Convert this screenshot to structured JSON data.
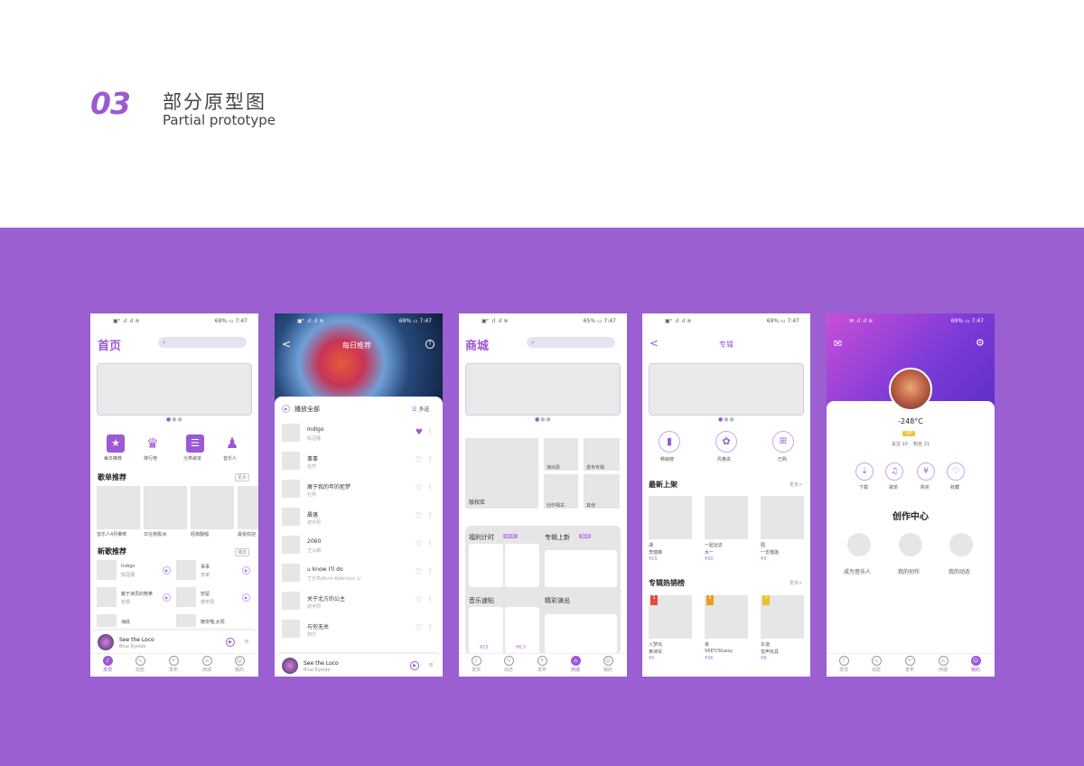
{
  "header": {
    "number": "03",
    "title_zh": "部分原型图",
    "title_en": "Partial prototype"
  },
  "colors": {
    "accent": "#9b59d3",
    "band": "#9b5fd1"
  },
  "phone1": {
    "status": {
      "left": "▣ᵉ .ıl .ıl ≋",
      "right": "69% ▭ 7:47"
    },
    "title": "首页",
    "icons": [
      {
        "label": "每日推荐",
        "icon": "star-bookmark-icon"
      },
      {
        "label": "排行榜",
        "icon": "trophy-icon"
      },
      {
        "label": "分类歌单",
        "icon": "playlist-icon"
      },
      {
        "label": "音乐人",
        "icon": "person-icon"
      }
    ],
    "playlist_section": "歌单推荐",
    "playlist_more": "更多",
    "playlists": [
      "音乐人4月推荐",
      "日在南极洲",
      "经典翻唱",
      "最受欢迎"
    ],
    "newsong_section": "新歌推荐",
    "newsong_more": "播放",
    "newsongs": [
      {
        "name": "Indigo",
        "artist": "陈冠蒲"
      },
      {
        "name": "事事",
        "artist": "李荣"
      },
      {
        "name": "戴于演员的鞋拳",
        "artist": "杜杨"
      },
      {
        "name": "想留",
        "artist": "谢宇周"
      },
      {
        "name": "海底",
        "artist": ""
      },
      {
        "name": "晚安喵,太阳",
        "artist": ""
      }
    ],
    "mini": {
      "title": "See the Loco",
      "artist": "Blue Eyeide"
    },
    "tabs": [
      "发现",
      "动态",
      "发布",
      "商城",
      "我的"
    ]
  },
  "phone2": {
    "status": {
      "left": "▣ᵉ .ıl .ıl ≋",
      "right": "69% ▭ 7:47"
    },
    "title": "每日推荐",
    "play_all": "播放全部",
    "multi": "多选",
    "songs": [
      {
        "name": "Indigo",
        "artist": "陈冠蒲"
      },
      {
        "name": "事事",
        "artist": "任然"
      },
      {
        "name": "屑于我的年的拒梦",
        "artist": "杜杨"
      },
      {
        "name": "晨落",
        "artist": "谢宇周"
      },
      {
        "name": "2060",
        "artist": "王以朗"
      },
      {
        "name": "u know I'll do",
        "artist": "丁光亮/Alvin Robinson Li"
      },
      {
        "name": "关于北方的公主",
        "artist": "谢宇周"
      },
      {
        "name": "与你无关",
        "artist": "阿冗"
      }
    ],
    "mini": {
      "title": "See the Loco",
      "artist": "Blue Eyeide"
    }
  },
  "phone3": {
    "status": {
      "left": "▣ᵉ .ıl .ıl ≋",
      "right": "65% ▭ 7:47"
    },
    "title": "商城",
    "tiles": [
      "版权库",
      "演出票",
      "发布专辑",
      "创作相关",
      "其他"
    ],
    "welfare": "福利计时",
    "new_album": "专辑上新",
    "sticker": "音乐速贴",
    "show": "精彩演出",
    "prices": [
      "¥15",
      "¥6.5"
    ],
    "tabs": [
      "发现",
      "动态",
      "发布",
      "商城",
      "我的"
    ]
  },
  "phone4": {
    "status": {
      "left": "▣ᵉ .ıl .ıl ≋",
      "right": "69% ▭ 7:47"
    },
    "title": "专辑",
    "cats": [
      "畅销榜",
      "风格说",
      "已购"
    ],
    "latest": "最新上架",
    "latest_more": "更多>",
    "albums": [
      {
        "name": "湖",
        "artist": "李健峰",
        "price": "¥15"
      },
      {
        "name": "一起远去",
        "artist": "水一",
        "price": "¥30"
      },
      {
        "name": "囿",
        "artist": "一支榴莲",
        "price": "¥3"
      }
    ],
    "hot": "专辑热销榜",
    "hot_more": "更多>",
    "hots": [
      {
        "rank": "1",
        "name": "入梦出",
        "artist": "黄诗扶",
        "price": "¥5",
        "color": "#e14c3b"
      },
      {
        "rank": "2",
        "name": "夜",
        "artist": "VKEY/Stussy",
        "price": "¥36",
        "color": "#f09a1f"
      },
      {
        "rank": "3",
        "name": "失谐",
        "artist": "音声玩具",
        "price": "¥8",
        "color": "#e8c225"
      }
    ]
  },
  "phone5": {
    "status": {
      "left": "✉ .ıl .ıl ≋",
      "right": "69% ▭ 7:47"
    },
    "name": "-248°C",
    "vip": "VIP",
    "stats": "关注 10    粉丝 21",
    "actions": [
      "下载",
      "歌单",
      "购买",
      "收藏"
    ],
    "center": "创作中心",
    "center_items": [
      "成为音乐人",
      "我的创作",
      "我的动态"
    ],
    "tabs": [
      "发现",
      "动态",
      "发布",
      "商城",
      "我的"
    ]
  }
}
